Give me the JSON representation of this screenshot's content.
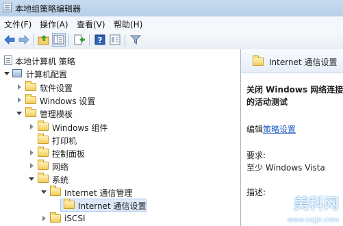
{
  "window": {
    "title": "本地组策略编辑器"
  },
  "menu": {
    "items": [
      "文件(F)",
      "操作(A)",
      "查看(V)",
      "帮助(H)"
    ]
  },
  "toolbar": {
    "buttons": [
      "back-arrow-icon",
      "forward-arrow-icon",
      "up-folder-icon",
      "show-hide-tree-icon",
      "export-list-icon",
      "help-icon",
      "properties-icon",
      "filter-icon"
    ]
  },
  "tree": {
    "root": "本地计算机 策略",
    "computer_config": "计算机配置",
    "software_settings": "软件设置",
    "windows_settings": "Windows 设置",
    "admin_templates": "管理模板",
    "windows_components": "Windows 组件",
    "printers": "打印机",
    "control_panel": "控制面板",
    "network": "网络",
    "system": "系统",
    "internet_comm_mgmt": "Internet 通信管理",
    "internet_comm_settings": "Internet 通信设置",
    "iscsi": "iSCSI"
  },
  "detail": {
    "header_title": "Internet 通信设置",
    "setting_title_line1": "关闭 Windows 网络连接",
    "setting_title_line2": "的活动测试",
    "edit_prefix": "编辑",
    "edit_link": "策略设置",
    "requirements_label": "要求:",
    "requirements_value": "至少 Windows Vista",
    "description_label": "描述:"
  },
  "watermark": {
    "text": "美科网",
    "subtext": "www.xajjn.com"
  }
}
